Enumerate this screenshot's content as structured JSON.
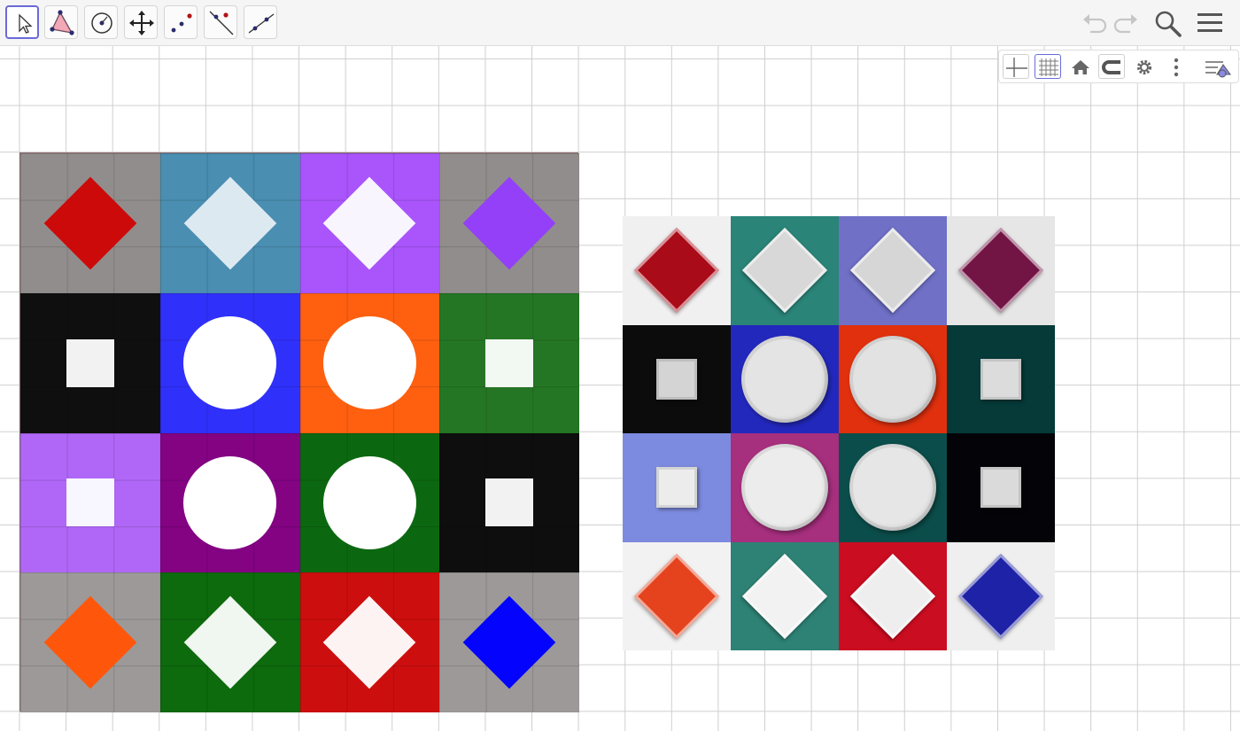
{
  "toolbar": {
    "tools": [
      {
        "name": "move-tool",
        "icon": "arrow-cursor-icon",
        "active": true
      },
      {
        "name": "polygon-tool",
        "icon": "polygon-icon",
        "active": false
      },
      {
        "name": "circle-tool",
        "icon": "circle-center-icon",
        "active": false
      },
      {
        "name": "move-graphics-view-tool",
        "icon": "move-arrows-icon",
        "active": false
      },
      {
        "name": "point-tool",
        "icon": "points-icon",
        "active": false
      },
      {
        "name": "perpendicular-line-tool",
        "icon": "perpendicular-icon",
        "active": false
      },
      {
        "name": "line-tool",
        "icon": "line-icon",
        "active": false
      }
    ],
    "right_icons": [
      "undo-icon",
      "redo-icon",
      "search-icon",
      "menu-icon"
    ]
  },
  "style_bar": {
    "buttons": [
      "axes-toggle-icon",
      "grid-toggle-icon",
      "home-icon",
      "point-capturing-icon",
      "settings-icon",
      "more-vertical-icon",
      "algebra-toggle-icon"
    ],
    "grid_on": true
  },
  "model": {
    "rows": [
      [
        {
          "bg": "#918d8c",
          "shape": "diamond",
          "fill": "#cc0a0a"
        },
        {
          "bg": "#4a8eb1",
          "shape": "diamond",
          "fill": "#dde9f1"
        },
        {
          "bg": "#a955fb",
          "shape": "diamond",
          "fill": "#f8f5fe"
        },
        {
          "bg": "#918d8c",
          "shape": "diamond",
          "fill": "#9340f8"
        }
      ],
      [
        {
          "bg": "#0f0f0f",
          "shape": "square",
          "fill": "#f2f2f2"
        },
        {
          "bg": "#3030fb",
          "shape": "circle",
          "fill": "#ffffff"
        },
        {
          "bg": "#fe6010",
          "shape": "circle",
          "fill": "#ffffff"
        },
        {
          "bg": "#247624",
          "shape": "square",
          "fill": "#f2f8f2"
        }
      ],
      [
        {
          "bg": "#b067f7",
          "shape": "square",
          "fill": "#f8f6fe"
        },
        {
          "bg": "#830383",
          "shape": "circle",
          "fill": "#ffffff"
        },
        {
          "bg": "#0c6810",
          "shape": "circle",
          "fill": "#ffffff"
        },
        {
          "bg": "#0e0e0e",
          "shape": "square",
          "fill": "#f2f2f2"
        }
      ],
      [
        {
          "bg": "#9c9998",
          "shape": "diamond",
          "fill": "#fe570c"
        },
        {
          "bg": "#0d6a0d",
          "shape": "diamond",
          "fill": "#f0f6f0"
        },
        {
          "bg": "#cd0e0e",
          "shape": "diamond",
          "fill": "#fdf3f3"
        },
        {
          "bg": "#9c9998",
          "shape": "diamond",
          "fill": "#0303fe"
        }
      ]
    ]
  },
  "photo": {
    "rows": [
      [
        {
          "bg": "#f0f0f0",
          "shape": "diamond",
          "fill": "#a90b18"
        },
        {
          "bg": "#2a8478",
          "shape": "diamond",
          "fill": "#d8d8d8"
        },
        {
          "bg": "#6f70c6",
          "shape": "diamond",
          "fill": "#d6d6d6"
        },
        {
          "bg": "#e6e6e6",
          "shape": "diamond",
          "fill": "#721545"
        }
      ],
      [
        {
          "bg": "#0c0c0c",
          "shape": "square",
          "fill": "#d4d4d4"
        },
        {
          "bg": "#2328bd",
          "shape": "circle",
          "fill": "#e4e4e4"
        },
        {
          "bg": "#e0300e",
          "shape": "circle",
          "fill": "#e2e2e2"
        },
        {
          "bg": "#053a38",
          "shape": "square",
          "fill": "#dcdcdc"
        }
      ],
      [
        {
          "bg": "#7c8bdf",
          "shape": "square",
          "fill": "#ececec"
        },
        {
          "bg": "#a62f7e",
          "shape": "circle",
          "fill": "#ececec"
        },
        {
          "bg": "#0b4d4a",
          "shape": "circle",
          "fill": "#e6e6e6"
        },
        {
          "bg": "#040408",
          "shape": "square",
          "fill": "#dadada"
        }
      ],
      [
        {
          "bg": "#f2f2f2",
          "shape": "diamond",
          "fill": "#e4431e"
        },
        {
          "bg": "#2e8275",
          "shape": "diamond",
          "fill": "#f2f2f2"
        },
        {
          "bg": "#cb0d21",
          "shape": "diamond",
          "fill": "#eeeeee"
        },
        {
          "bg": "#efefef",
          "shape": "diamond",
          "fill": "#1d22a6"
        }
      ]
    ]
  }
}
